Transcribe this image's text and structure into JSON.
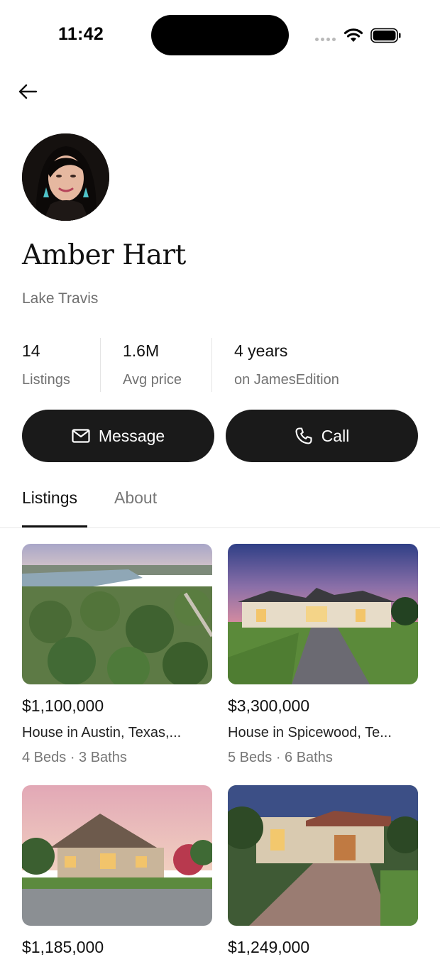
{
  "status_bar": {
    "time": "11:42"
  },
  "agent": {
    "name": "Amber Hart",
    "location": "Lake Travis"
  },
  "stats": [
    {
      "value": "14",
      "label": "Listings"
    },
    {
      "value": "1.6M",
      "label": "Avg price"
    },
    {
      "value": "4 years",
      "label": "on JamesEdition"
    }
  ],
  "actions": {
    "message_label": "Message",
    "call_label": "Call"
  },
  "tabs": [
    {
      "label": "Listings",
      "active": true
    },
    {
      "label": "About",
      "active": false
    }
  ],
  "listings": [
    {
      "price": "$1,100,000",
      "title": "House in Austin, Texas,...",
      "meta": "4 Beds · 3 Baths"
    },
    {
      "price": "$3,300,000",
      "title": "House in Spicewood, Te...",
      "meta": "5 Beds · 6 Baths"
    },
    {
      "price": "$1,185,000",
      "title": "",
      "meta": ""
    },
    {
      "price": "$1,249,000",
      "title": "",
      "meta": ""
    }
  ],
  "colors": {
    "button_bg": "#1a1a1a",
    "muted_text": "#727272",
    "divider": "#e4e4e4"
  }
}
